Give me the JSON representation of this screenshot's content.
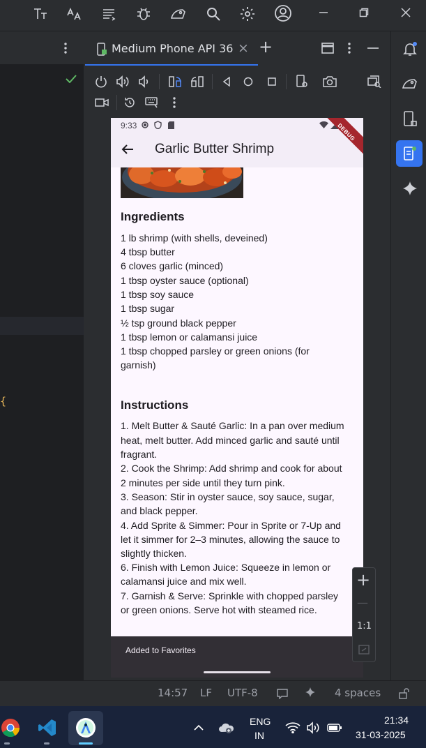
{
  "window": {
    "tab_label": "Medium Phone API 36",
    "tab_close": "×",
    "tab_add": "+"
  },
  "colors": {
    "accent": "#3574f0",
    "app_bar": "#f3edf7",
    "phone_bg": "#fdf7ff",
    "snackbar": "#322f35",
    "check": "#5fb865"
  },
  "phone": {
    "time": "9:33",
    "debug_label": "DEBUG",
    "title": "Garlic Butter Shrimp",
    "ingredients_heading": "Ingredients",
    "ingredients": [
      "1 lb shrimp (with shells, deveined)",
      "4 tbsp butter",
      "6 cloves garlic (minced)",
      "1 tbsp oyster sauce (optional)",
      "1 tbsp soy sauce",
      "1 tbsp sugar",
      "½ tsp ground black pepper",
      "1 tbsp lemon or calamansi juice",
      "1 tbsp chopped parsley or green onions (for",
      "garnish)"
    ],
    "instructions_heading": "Instructions",
    "instructions": [
      "1. Melt Butter & Sauté Garlic: In a pan over medium",
      "heat, melt butter. Add minced garlic and sauté until",
      "fragrant.",
      "2. Cook the Shrimp: Add shrimp and cook for about",
      "2 minutes per side until they turn pink.",
      "3. Season: Stir in oyster sauce, soy sauce, sugar,",
      "and black pepper.",
      "4. Add Sprite & Simmer: Pour in Sprite or 7-Up and",
      "let it simmer for 2–3 minutes, allowing the sauce to",
      "slightly thicken.",
      "6. Finish with Lemon Juice: Squeeze in lemon or",
      "calamansi juice and mix well.",
      "7. Garnish & Serve: Sprinkle with chopped parsley",
      "or green onions. Serve hot with steamed rice."
    ],
    "snackbar_text": "Added to Favorites"
  },
  "zoom": {
    "plus": "+",
    "minus": "—",
    "ratio": "1:1"
  },
  "statusbar": {
    "position": "14:57",
    "line_ending": "LF",
    "encoding": "UTF-8",
    "indent": "4 spaces"
  },
  "taskbar": {
    "lang_top": "ENG",
    "lang_bottom": "IN",
    "time": "21:34",
    "date": "31-03-2025"
  },
  "left_snippet": "{"
}
